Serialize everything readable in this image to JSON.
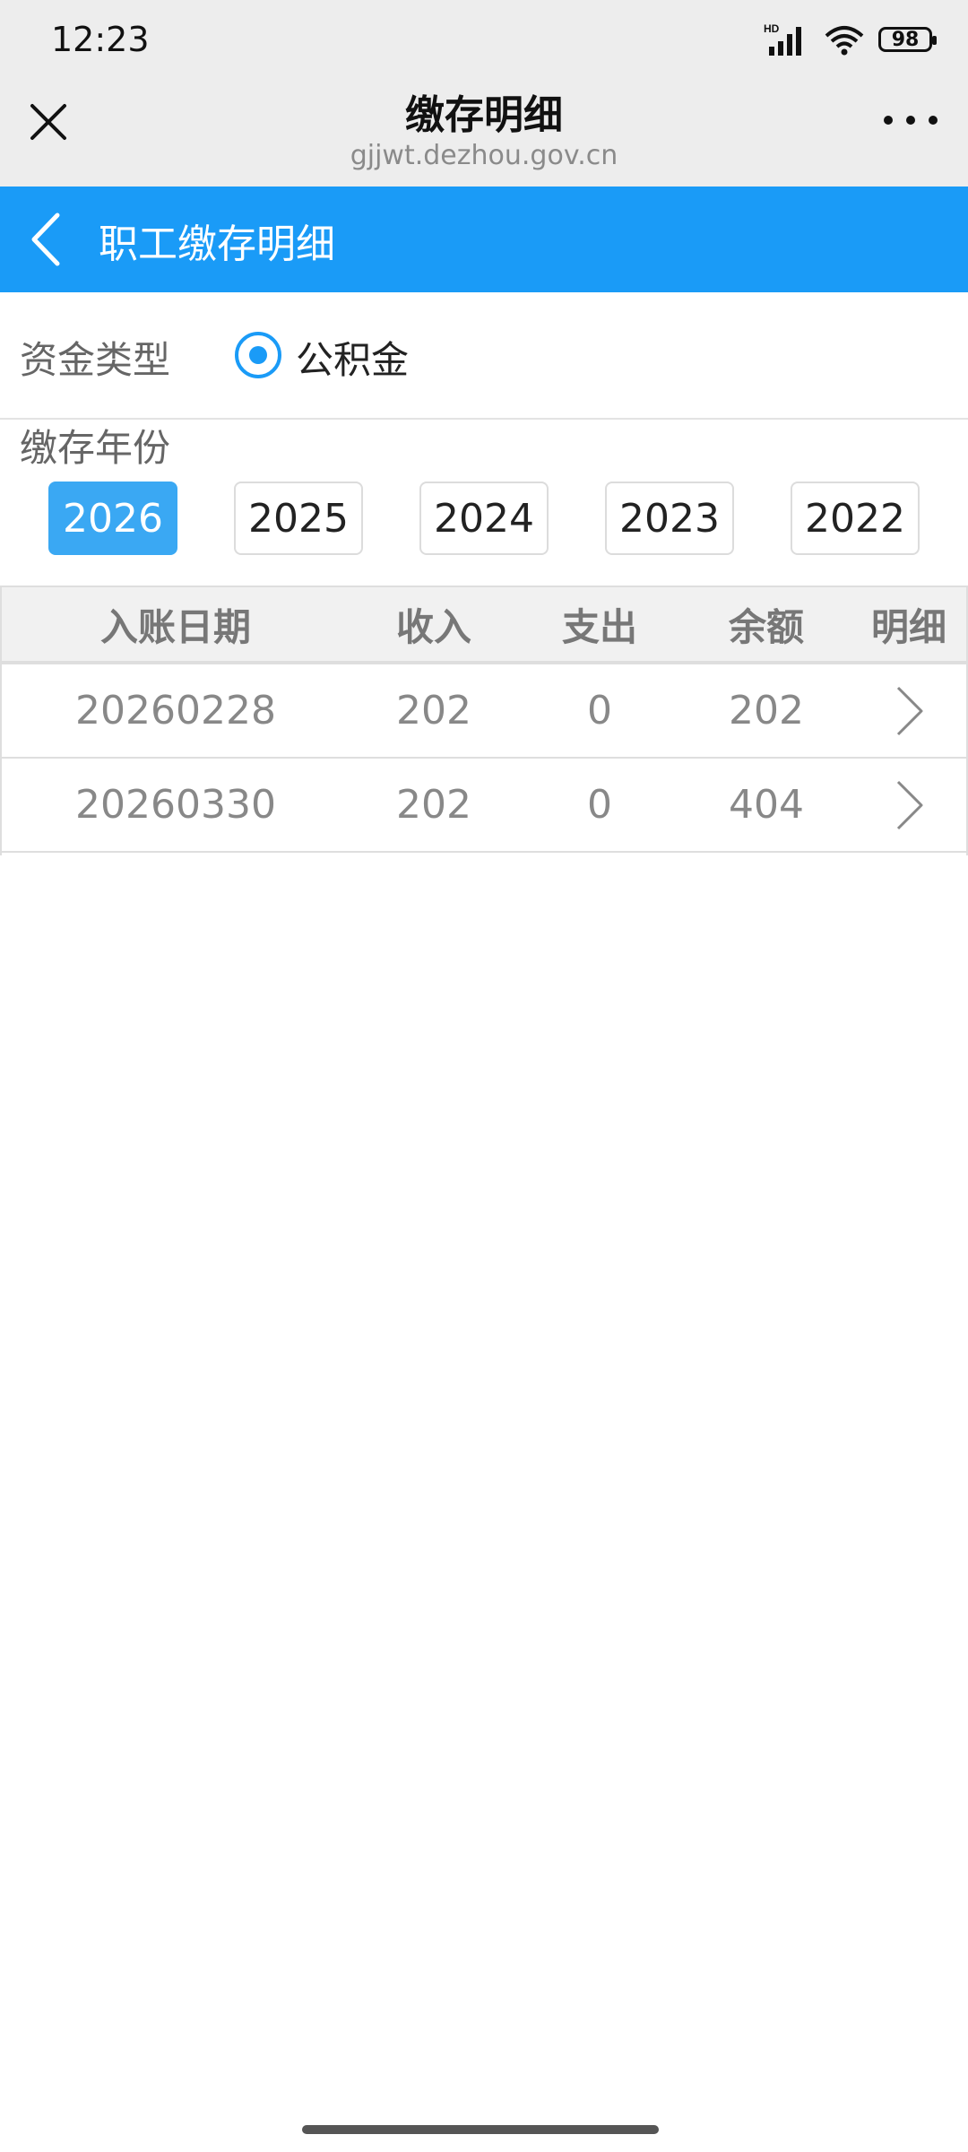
{
  "status_bar": {
    "time": "12:23",
    "network": "HD",
    "battery": "98"
  },
  "browser": {
    "title": "缴存明细",
    "url": "gjjwt.dezhou.gov.cn",
    "icons": {
      "close": "close-icon",
      "more": "more-icon"
    }
  },
  "header": {
    "title": "职工缴存明细",
    "back_icon": "chevron-left-icon",
    "color": "#1a9bf7"
  },
  "fund_type": {
    "label": "资金类型",
    "selected_option": "公积金"
  },
  "years": {
    "label": "缴存年份",
    "options": [
      "2026",
      "2025",
      "2024",
      "2023",
      "2022"
    ],
    "selected": "2026",
    "active_color": "#3aa8f3"
  },
  "table": {
    "headers": [
      "入账日期",
      "收入",
      "支出",
      "余额",
      "明细"
    ],
    "rows": [
      {
        "date": "20260228",
        "income": "202",
        "expense": "0",
        "balance": "202"
      },
      {
        "date": "20260330",
        "income": "202",
        "expense": "0",
        "balance": "404"
      }
    ],
    "detail_icon": "chevron-right-icon"
  }
}
